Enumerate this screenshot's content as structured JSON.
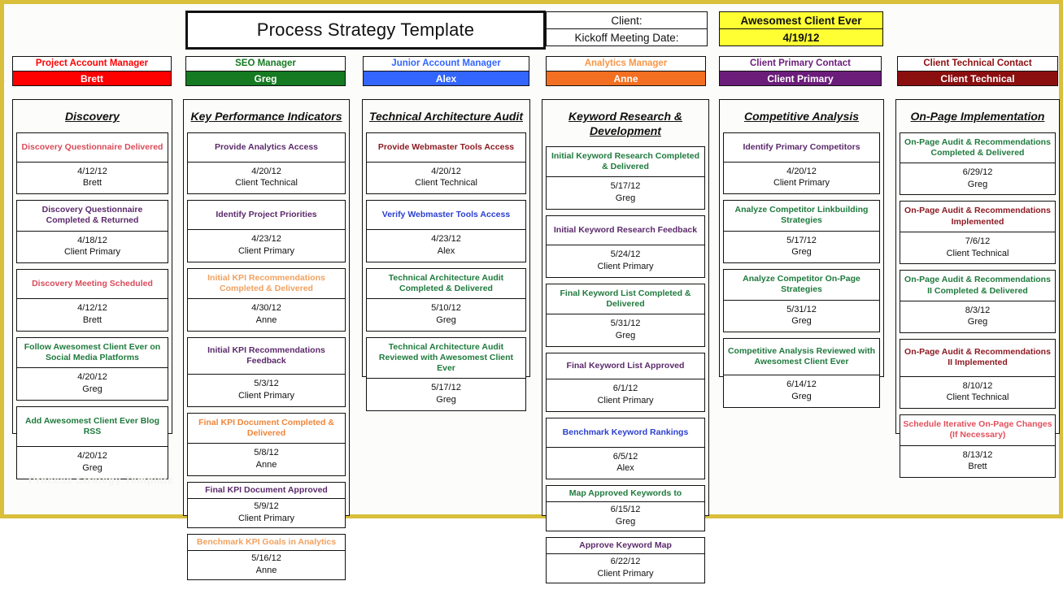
{
  "document": {
    "title": "Process Strategy Template",
    "watermark": "Process Strategy Template"
  },
  "header": {
    "client_label": "Client:",
    "kickoff_label": "Kickoff Meeting Date:",
    "client_name": "Awesomest Client Ever",
    "kickoff_date": "4/19/12",
    "highlight_color": "#ffff33",
    "roles": [
      {
        "title": "Project Account Manager",
        "name": "Brett",
        "title_color": "#ff0000",
        "fill": "#ff0000"
      },
      {
        "title": "SEO Manager",
        "name": "Greg",
        "title_color": "#157a21",
        "fill": "#157a21"
      },
      {
        "title": "Junior Account Manager",
        "name": "Alex",
        "title_color": "#3366ff",
        "fill": "#3366ff"
      },
      {
        "title": "Analytics Manager",
        "name": "Anne",
        "title_color": "#f79646",
        "fill": "#f36f21"
      },
      {
        "title": "Client Primary Contact",
        "name": "Client Primary",
        "title_color": "#6b1d7a",
        "fill": "#6b1d7a"
      },
      {
        "title": "Client Technical Contact",
        "name": "Client Technical",
        "title_color": "#8c0f10",
        "fill": "#8c0f10"
      }
    ]
  },
  "colors": {
    "red": "#d94b5a",
    "purple": "#5b2a6b",
    "green": "#1f7a3d",
    "orange": "#f0a160",
    "blue": "#2b3fd0",
    "darkred": "#8c1a22",
    "border": "#d9bf3b"
  },
  "columns": [
    {
      "heading": "Discovery",
      "tasks": [
        {
          "title": "Discovery Questionnaire Delivered",
          "color": "#d94b5a",
          "date": "4/12/12",
          "owner": "Brett",
          "size": "tall"
        },
        {
          "title": "Discovery Questionnaire Completed & Returned",
          "color": "#5b2a6b",
          "date": "4/18/12",
          "owner": "Client Primary",
          "size": "normal"
        },
        {
          "title": "Discovery Meeting Scheduled",
          "color": "#d94b5a",
          "date": "4/12/12",
          "owner": "Brett",
          "size": "tall"
        },
        {
          "title": "Follow Awesomest Client Ever on Social Media Platforms",
          "color": "#1f7a3d",
          "date": "4/20/12",
          "owner": "Greg",
          "size": "normal"
        },
        {
          "title": "Add Awesomest Client Ever Blog RSS",
          "color": "#1f7a3d",
          "date": "4/20/12",
          "owner": "Greg",
          "size": "tall"
        }
      ]
    },
    {
      "heading": "Key Performance Indicators",
      "tasks": [
        {
          "title": "Provide Analytics Access",
          "color": "#5b2a6b",
          "date": "4/20/12",
          "owner": "Client Technical",
          "size": "tall"
        },
        {
          "title": "Identify Project Priorities",
          "color": "#5b2a6b",
          "date": "4/23/12",
          "owner": "Client Primary",
          "size": "tall"
        },
        {
          "title": "Initial KPI Recommendations Completed & Delivered",
          "color": "#f0a160",
          "date": "4/30/12",
          "owner": "Anne",
          "size": "normal"
        },
        {
          "title": "Initial KPI Recommendations Feedback",
          "color": "#5b2a6b",
          "date": "5/3/12",
          "owner": "Client Primary",
          "size": "tall2"
        },
        {
          "title": "Final KPI Document Completed & Delivered",
          "color": "#f0853a",
          "date": "5/8/12",
          "owner": "Anne",
          "size": "normal"
        },
        {
          "title": "Final KPI Document Approved",
          "color": "#5b2a6b",
          "date": "5/9/12",
          "owner": "Client Primary",
          "size": "compact"
        },
        {
          "title": "Benchmark KPI Goals in Analytics",
          "color": "#f0a160",
          "date": "5/16/12",
          "owner": "Anne",
          "size": "compact"
        }
      ]
    },
    {
      "heading": "Technical Architecture Audit",
      "tasks": [
        {
          "title": "Provide Webmaster Tools Access",
          "color": "#8c1a22",
          "date": "4/20/12",
          "owner": "Client Technical",
          "size": "tall"
        },
        {
          "title": "Verify Webmaster Tools Access",
          "color": "#2b3fd0",
          "date": "4/23/12",
          "owner": "Alex",
          "size": "tall"
        },
        {
          "title": "Technical Architecture Audit Completed & Delivered",
          "color": "#1f7a3d",
          "date": "5/10/12",
          "owner": "Greg",
          "size": "normal"
        },
        {
          "title": "Technical Architecture Audit Reviewed with Awesomest Client Ever",
          "color": "#1f7a3d",
          "date": "5/17/12",
          "owner": "Greg",
          "size": "three"
        }
      ]
    },
    {
      "heading": "Keyword Research & Development",
      "tasks": [
        {
          "title": "Initial Keyword Research Completed & Delivered",
          "color": "#1f7a3d",
          "date": "5/17/12",
          "owner": "Greg",
          "size": "normal"
        },
        {
          "title": "Initial Keyword Research Feedback",
          "color": "#5b2a6b",
          "date": "5/24/12",
          "owner": "Client Primary",
          "size": "tall"
        },
        {
          "title": "Final Keyword List Completed & Delivered",
          "color": "#1f7a3d",
          "date": "5/31/12",
          "owner": "Greg",
          "size": "normal"
        },
        {
          "title": "Final Keyword List Approved",
          "color": "#5b2a6b",
          "date": "6/1/12",
          "owner": "Client Primary",
          "size": "tall2"
        },
        {
          "title": "Benchmark Keyword Rankings",
          "color": "#2b3fd0",
          "date": "6/5/12",
          "owner": "Alex",
          "size": "tall"
        },
        {
          "title": "Map Approved Keywords to",
          "color": "#1f7a3d",
          "date": "6/15/12",
          "owner": "Greg",
          "size": "compact"
        },
        {
          "title": "Approve Keyword Map",
          "color": "#5b2a6b",
          "date": "6/22/12",
          "owner": "Client Primary",
          "size": "compact"
        }
      ]
    },
    {
      "heading": "Competitive Analysis",
      "tasks": [
        {
          "title": "Identify Primary Competitors",
          "color": "#5b2a6b",
          "date": "4/20/12",
          "owner": "Client Primary",
          "size": "tall"
        },
        {
          "title": "Analyze Competitor Linkbuilding Strategies",
          "color": "#1f7a3d",
          "date": "5/17/12",
          "owner": "Greg",
          "size": "normal"
        },
        {
          "title": "Analyze Competitor On-Page Strategies",
          "color": "#1f7a3d",
          "date": "5/31/12",
          "owner": "Greg",
          "size": "normal"
        },
        {
          "title": "Competitive Analysis Reviewed with Awesomest Client Ever",
          "color": "#1f7a3d",
          "date": "6/14/12",
          "owner": "Greg",
          "size": "tall2"
        }
      ]
    },
    {
      "heading": "On-Page Implementation",
      "tasks": [
        {
          "title": "On-Page Audit & Recommendations Completed & Delivered",
          "color": "#1f7a3d",
          "date": "6/29/12",
          "owner": "Greg",
          "size": "normal"
        },
        {
          "title": "On-Page Audit & Recommendations Implemented",
          "color": "#8c1a22",
          "date": "7/6/12",
          "owner": "Client Technical",
          "size": "normal"
        },
        {
          "title": "On-Page Audit & Recommendations II Completed & Delivered",
          "color": "#1f7a3d",
          "date": "8/3/12",
          "owner": "Greg",
          "size": "normal"
        },
        {
          "title": "On-Page Audit & Recommendations II Implemented",
          "color": "#8c1a22",
          "date": "8/10/12",
          "owner": "Client Technical",
          "size": "tall2"
        },
        {
          "title": "Schedule Iterative On-Page Changes (If Necessary)",
          "color": "#e2505c",
          "date": "8/13/12",
          "owner": "Brett",
          "size": "normal"
        }
      ]
    }
  ]
}
